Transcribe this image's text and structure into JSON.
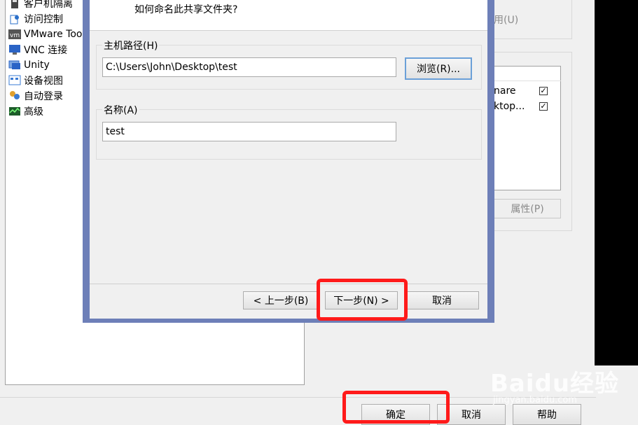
{
  "left_nav": {
    "items": [
      {
        "label": "客户机隔离",
        "icon": "isolation-icon"
      },
      {
        "label": "访问控制",
        "icon": "access-control-icon"
      },
      {
        "label": "VMware Too",
        "icon": "vmware-tools-icon"
      },
      {
        "label": "VNC 连接",
        "icon": "vnc-icon"
      },
      {
        "label": "Unity",
        "icon": "unity-icon"
      },
      {
        "label": "设备视图",
        "icon": "device-view-icon"
      },
      {
        "label": "自动登录",
        "icon": "autologin-icon"
      },
      {
        "label": "高级",
        "icon": "advanced-icon"
      }
    ]
  },
  "right_panel": {
    "disabled_text_fragment": "用(U)",
    "list_rows": [
      {
        "text": "nare",
        "checked": true
      },
      {
        "text": "ktop...",
        "checked": true
      }
    ],
    "properties_button": "属性(P)"
  },
  "dialog": {
    "header_text": "如何命名此共享文件夹?",
    "host_path_label": "主机路径(H)",
    "host_path_value": "C:\\Users\\John\\Desktop\\test",
    "browse_button": "浏览(R)...",
    "name_label": "名称(A)",
    "name_value": "test",
    "back_button": "< 上一步(B)",
    "next_button": "下一步(N) >",
    "cancel_button": "取消"
  },
  "bottom_bar": {
    "ok_button": "确定",
    "cancel_button": "取消",
    "help_button": "帮助"
  },
  "watermark": {
    "brand": "Baidu经验",
    "url": "jingyan.baidu.com"
  },
  "colors": {
    "dialog_frame": "#6d7fb8",
    "highlight": "#ff1a1a"
  }
}
